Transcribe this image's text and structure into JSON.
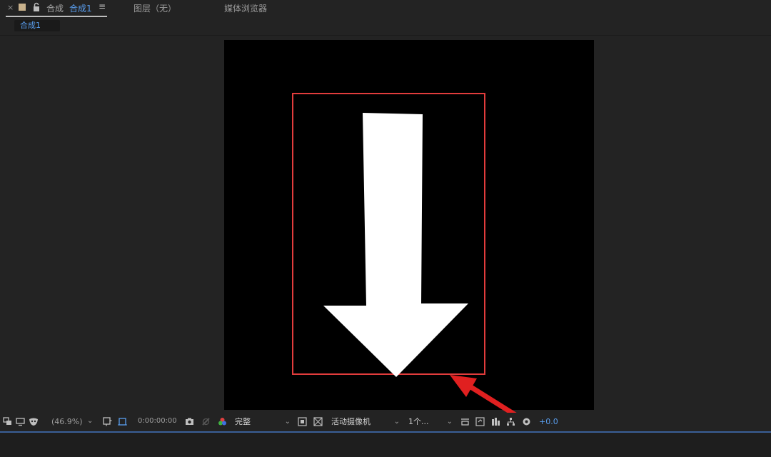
{
  "tabs": {
    "main_label": "合成",
    "main_active": "合成1",
    "layer": "图层（无）",
    "media": "媒体浏览器"
  },
  "breadcrumb": "合成1",
  "toolbar": {
    "zoom": "(46.9%)",
    "timecode": "0:00:00:00",
    "resolution": "完整",
    "camera": "活动摄像机",
    "views": "1个...",
    "exposure": "+0.0"
  },
  "colors": {
    "accent": "#5a9ff0",
    "selection": "#e23c3c",
    "annotation_arrow": "#e02020"
  }
}
